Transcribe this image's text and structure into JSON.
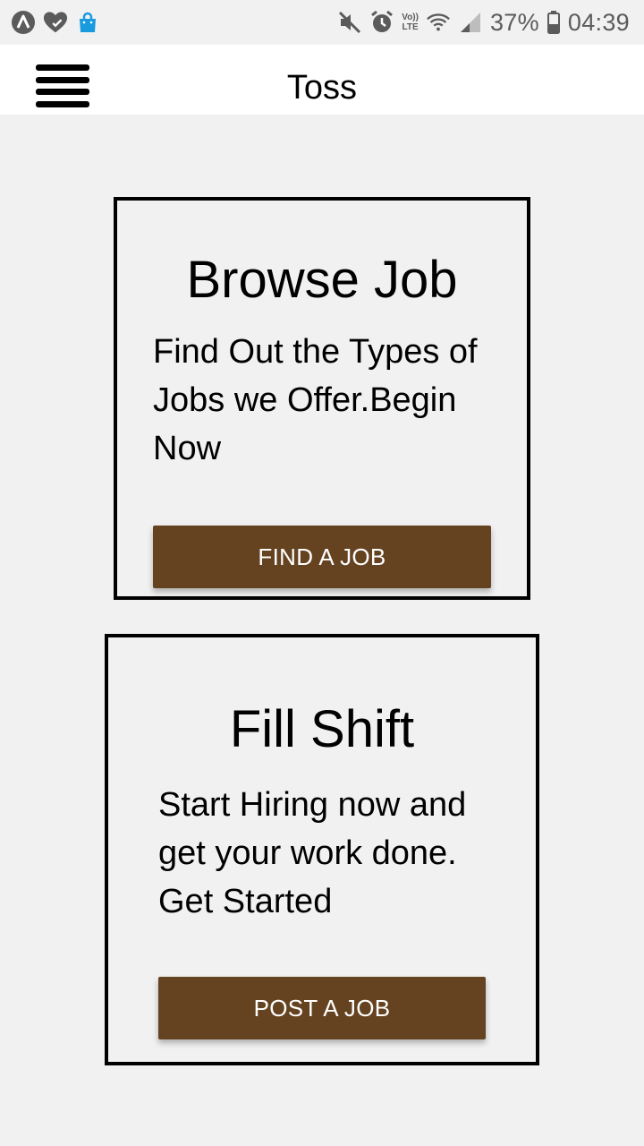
{
  "status_bar": {
    "battery": "37%",
    "time": "04:39",
    "network_top": "Vo))",
    "network_bottom": "LTE",
    "icons": [
      "app-a-icon",
      "health-heart-icon",
      "shopping-bag-icon",
      "mute-icon",
      "alarm-icon",
      "volte-lte-icon",
      "wifi-icon",
      "signal-icon",
      "battery-icon"
    ],
    "colors": {
      "bag": "#1a9be0",
      "icons": "#5b5b5b"
    }
  },
  "app_bar": {
    "title": "Toss",
    "menu_icon": "hamburger-menu-icon"
  },
  "cards": {
    "browse": {
      "title": "Browse Job",
      "description": "Find Out the Types of Jobs we Offer.Begin Now",
      "button_label": "FIND A JOB"
    },
    "fill": {
      "title": "Fill Shift",
      "description": "Start Hiring now and get your work done. Get Started",
      "button_label": "POST A JOB"
    }
  },
  "colors": {
    "background": "#f1f1f1",
    "app_bar": "#ffffff",
    "button": "#654321",
    "button_text": "#ffffff",
    "border": "#000000"
  }
}
